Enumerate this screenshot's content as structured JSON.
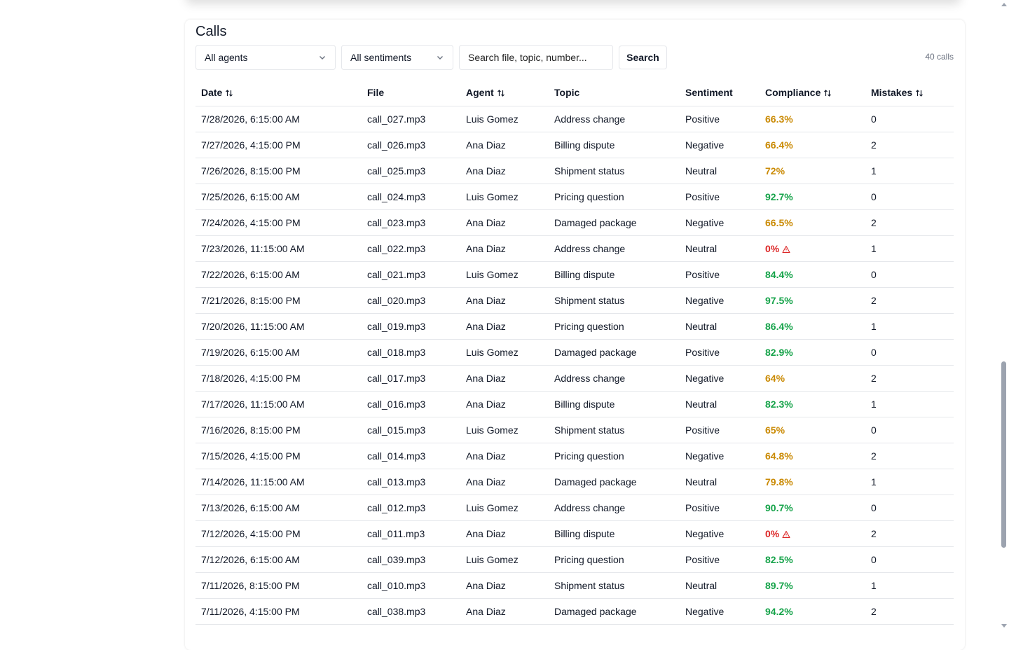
{
  "section": {
    "title": "Calls"
  },
  "filters": {
    "agent_selected": "All agents",
    "sentiment_selected": "All sentiments",
    "search_placeholder": "Search file, topic, number...",
    "search_button": "Search",
    "count_label": "40 calls"
  },
  "table": {
    "headers": {
      "date": "Date",
      "file": "File",
      "agent": "Agent",
      "topic": "Topic",
      "sentiment": "Sentiment",
      "compliance": "Compliance",
      "mistakes": "Mistakes"
    },
    "rows": [
      {
        "date": "7/28/2026, 6:15:00 AM",
        "file": "call_027.mp3",
        "agent": "Luis Gomez",
        "topic": "Address change",
        "sentiment": "Positive",
        "compliance": "66.3%",
        "level": "warn",
        "mistakes": "0"
      },
      {
        "date": "7/27/2026, 4:15:00 PM",
        "file": "call_026.mp3",
        "agent": "Ana Diaz",
        "topic": "Billing dispute",
        "sentiment": "Negative",
        "compliance": "66.4%",
        "level": "warn",
        "mistakes": "2"
      },
      {
        "date": "7/26/2026, 8:15:00 PM",
        "file": "call_025.mp3",
        "agent": "Ana Diaz",
        "topic": "Shipment status",
        "sentiment": "Neutral",
        "compliance": "72%",
        "level": "warn",
        "mistakes": "1"
      },
      {
        "date": "7/25/2026, 6:15:00 AM",
        "file": "call_024.mp3",
        "agent": "Luis Gomez",
        "topic": "Pricing question",
        "sentiment": "Positive",
        "compliance": "92.7%",
        "level": "good",
        "mistakes": "0"
      },
      {
        "date": "7/24/2026, 4:15:00 PM",
        "file": "call_023.mp3",
        "agent": "Ana Diaz",
        "topic": "Damaged package",
        "sentiment": "Negative",
        "compliance": "66.5%",
        "level": "warn",
        "mistakes": "2"
      },
      {
        "date": "7/23/2026, 11:15:00 AM",
        "file": "call_022.mp3",
        "agent": "Ana Diaz",
        "topic": "Address change",
        "sentiment": "Neutral",
        "compliance": "0%",
        "level": "bad",
        "mistakes": "1"
      },
      {
        "date": "7/22/2026, 6:15:00 AM",
        "file": "call_021.mp3",
        "agent": "Luis Gomez",
        "topic": "Billing dispute",
        "sentiment": "Positive",
        "compliance": "84.4%",
        "level": "good",
        "mistakes": "0"
      },
      {
        "date": "7/21/2026, 8:15:00 PM",
        "file": "call_020.mp3",
        "agent": "Ana Diaz",
        "topic": "Shipment status",
        "sentiment": "Negative",
        "compliance": "97.5%",
        "level": "good",
        "mistakes": "2"
      },
      {
        "date": "7/20/2026, 11:15:00 AM",
        "file": "call_019.mp3",
        "agent": "Ana Diaz",
        "topic": "Pricing question",
        "sentiment": "Neutral",
        "compliance": "86.4%",
        "level": "good",
        "mistakes": "1"
      },
      {
        "date": "7/19/2026, 6:15:00 AM",
        "file": "call_018.mp3",
        "agent": "Luis Gomez",
        "topic": "Damaged package",
        "sentiment": "Positive",
        "compliance": "82.9%",
        "level": "good",
        "mistakes": "0"
      },
      {
        "date": "7/18/2026, 4:15:00 PM",
        "file": "call_017.mp3",
        "agent": "Ana Diaz",
        "topic": "Address change",
        "sentiment": "Negative",
        "compliance": "64%",
        "level": "warn",
        "mistakes": "2"
      },
      {
        "date": "7/17/2026, 11:15:00 AM",
        "file": "call_016.mp3",
        "agent": "Ana Diaz",
        "topic": "Billing dispute",
        "sentiment": "Neutral",
        "compliance": "82.3%",
        "level": "good",
        "mistakes": "1"
      },
      {
        "date": "7/16/2026, 8:15:00 PM",
        "file": "call_015.mp3",
        "agent": "Luis Gomez",
        "topic": "Shipment status",
        "sentiment": "Positive",
        "compliance": "65%",
        "level": "warn",
        "mistakes": "0"
      },
      {
        "date": "7/15/2026, 4:15:00 PM",
        "file": "call_014.mp3",
        "agent": "Ana Diaz",
        "topic": "Pricing question",
        "sentiment": "Negative",
        "compliance": "64.8%",
        "level": "warn",
        "mistakes": "2"
      },
      {
        "date": "7/14/2026, 11:15:00 AM",
        "file": "call_013.mp3",
        "agent": "Ana Diaz",
        "topic": "Damaged package",
        "sentiment": "Neutral",
        "compliance": "79.8%",
        "level": "warn",
        "mistakes": "1"
      },
      {
        "date": "7/13/2026, 6:15:00 AM",
        "file": "call_012.mp3",
        "agent": "Luis Gomez",
        "topic": "Address change",
        "sentiment": "Positive",
        "compliance": "90.7%",
        "level": "good",
        "mistakes": "0"
      },
      {
        "date": "7/12/2026, 4:15:00 PM",
        "file": "call_011.mp3",
        "agent": "Ana Diaz",
        "topic": "Billing dispute",
        "sentiment": "Negative",
        "compliance": "0%",
        "level": "bad",
        "mistakes": "2"
      },
      {
        "date": "7/12/2026, 6:15:00 AM",
        "file": "call_039.mp3",
        "agent": "Luis Gomez",
        "topic": "Pricing question",
        "sentiment": "Positive",
        "compliance": "82.5%",
        "level": "good",
        "mistakes": "0"
      },
      {
        "date": "7/11/2026, 8:15:00 PM",
        "file": "call_010.mp3",
        "agent": "Ana Diaz",
        "topic": "Shipment status",
        "sentiment": "Neutral",
        "compliance": "89.7%",
        "level": "good",
        "mistakes": "1"
      },
      {
        "date": "7/11/2026, 4:15:00 PM",
        "file": "call_038.mp3",
        "agent": "Ana Diaz",
        "topic": "Damaged package",
        "sentiment": "Negative",
        "compliance": "94.2%",
        "level": "good",
        "mistakes": "2"
      }
    ]
  },
  "colors": {
    "good": "#16a34a",
    "warn": "#ca8a04",
    "bad": "#dc2626"
  },
  "icons": {
    "sort": "sort-arrows-icon",
    "dropdown": "chevron-down-icon",
    "warning": "warning-triangle-icon"
  }
}
